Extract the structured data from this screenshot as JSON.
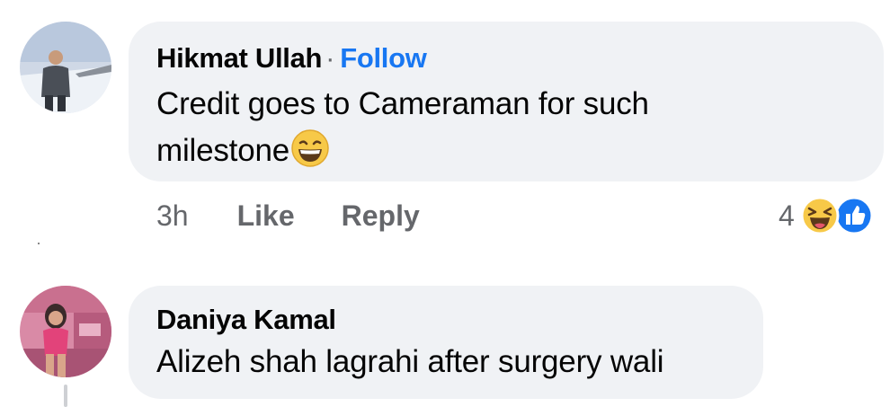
{
  "comments": [
    {
      "author": "Hikmat Ullah",
      "separator": "·",
      "follow_label": "Follow",
      "text": "Credit goes to Cameraman for such",
      "text_line2": "milestone",
      "inline_emoji": "grinning-squinting-face",
      "time": "3h",
      "like_label": "Like",
      "reply_label": "Reply",
      "reaction_count": "4",
      "reactions": [
        "haha",
        "like"
      ]
    },
    {
      "author": "Daniya Kamal",
      "text": "Alizeh shah lagrahi after surgery wali"
    }
  ],
  "colors": {
    "bubble": "#f0f2f5",
    "follow": "#1877f2",
    "meta": "#65676b",
    "like_reaction": "#1877f2",
    "haha_reaction": "#f7c948"
  }
}
